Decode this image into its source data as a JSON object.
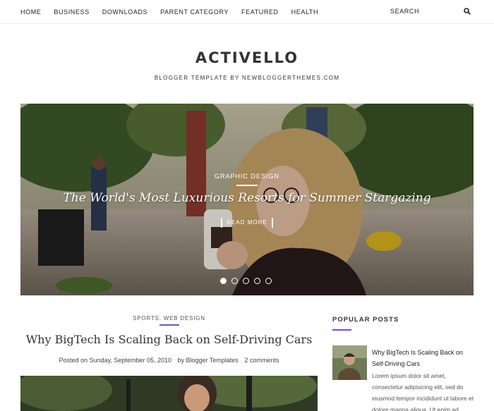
{
  "nav": {
    "items": [
      "HOME",
      "BUSINESS",
      "DOWNLOADS",
      "PARENT CATEGORY",
      "FEATURED",
      "HEALTH"
    ],
    "search_label": "SEARCH",
    "search_icon": "search-icon"
  },
  "header": {
    "title": "ACTIVELLO",
    "tagline": "BLOGGER TEMPLATE BY NEWBLOGGERTHEMES.COM"
  },
  "hero": {
    "category": "GRAPHIC DESIGN",
    "title": "The World's Most Luxurious Resorts for Summer Stargazing",
    "read_more": "READ MORE",
    "slide_count": 5,
    "active_slide": 1
  },
  "post": {
    "categories": "SPORTS, WEB DESIGN",
    "title": "Why BigTech Is Scaling Back on Self-Driving Cars",
    "date": "Posted on Sunday, September 05, 2010",
    "author": "by Blogger Templates",
    "comments": "2 comments"
  },
  "sidebar": {
    "popular_title": "POPULAR POSTS",
    "popular_posts": [
      {
        "title": "Why BigTech Is Scaling Back on Self-Driving Cars",
        "excerpt": "Lorem ipsum dolor sit amet, consectetur adipisicing elit, sed do eiusmod tempor incididunt ut labore et dolore magna aliqua. Ut enim ad min..."
      }
    ]
  },
  "colors": {
    "accent": "#7b4fbf",
    "text": "#333333"
  }
}
